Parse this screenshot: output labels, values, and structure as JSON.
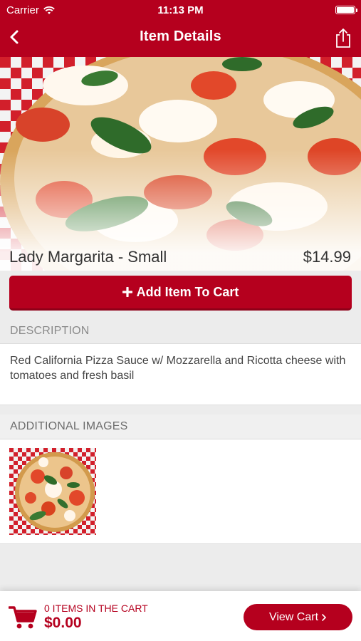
{
  "status_bar": {
    "carrier": "Carrier",
    "time": "11:13 PM"
  },
  "nav": {
    "title": "Item Details"
  },
  "item": {
    "name": "Lady Margarita - Small",
    "price": "$14.99",
    "add_label": "Add Item To Cart"
  },
  "description": {
    "heading": "DESCRIPTION",
    "text": "Red California Pizza Sauce w/ Mozzarella and Ricotta cheese with tomatoes and fresh basil"
  },
  "additional_images": {
    "heading": "ADDITIONAL IMAGES"
  },
  "cart": {
    "count_text": "0 ITEMS IN THE CART",
    "total": "$0.00",
    "view_label": "View Cart"
  },
  "colors": {
    "brand": "#b5001e",
    "background": "#ececec"
  }
}
